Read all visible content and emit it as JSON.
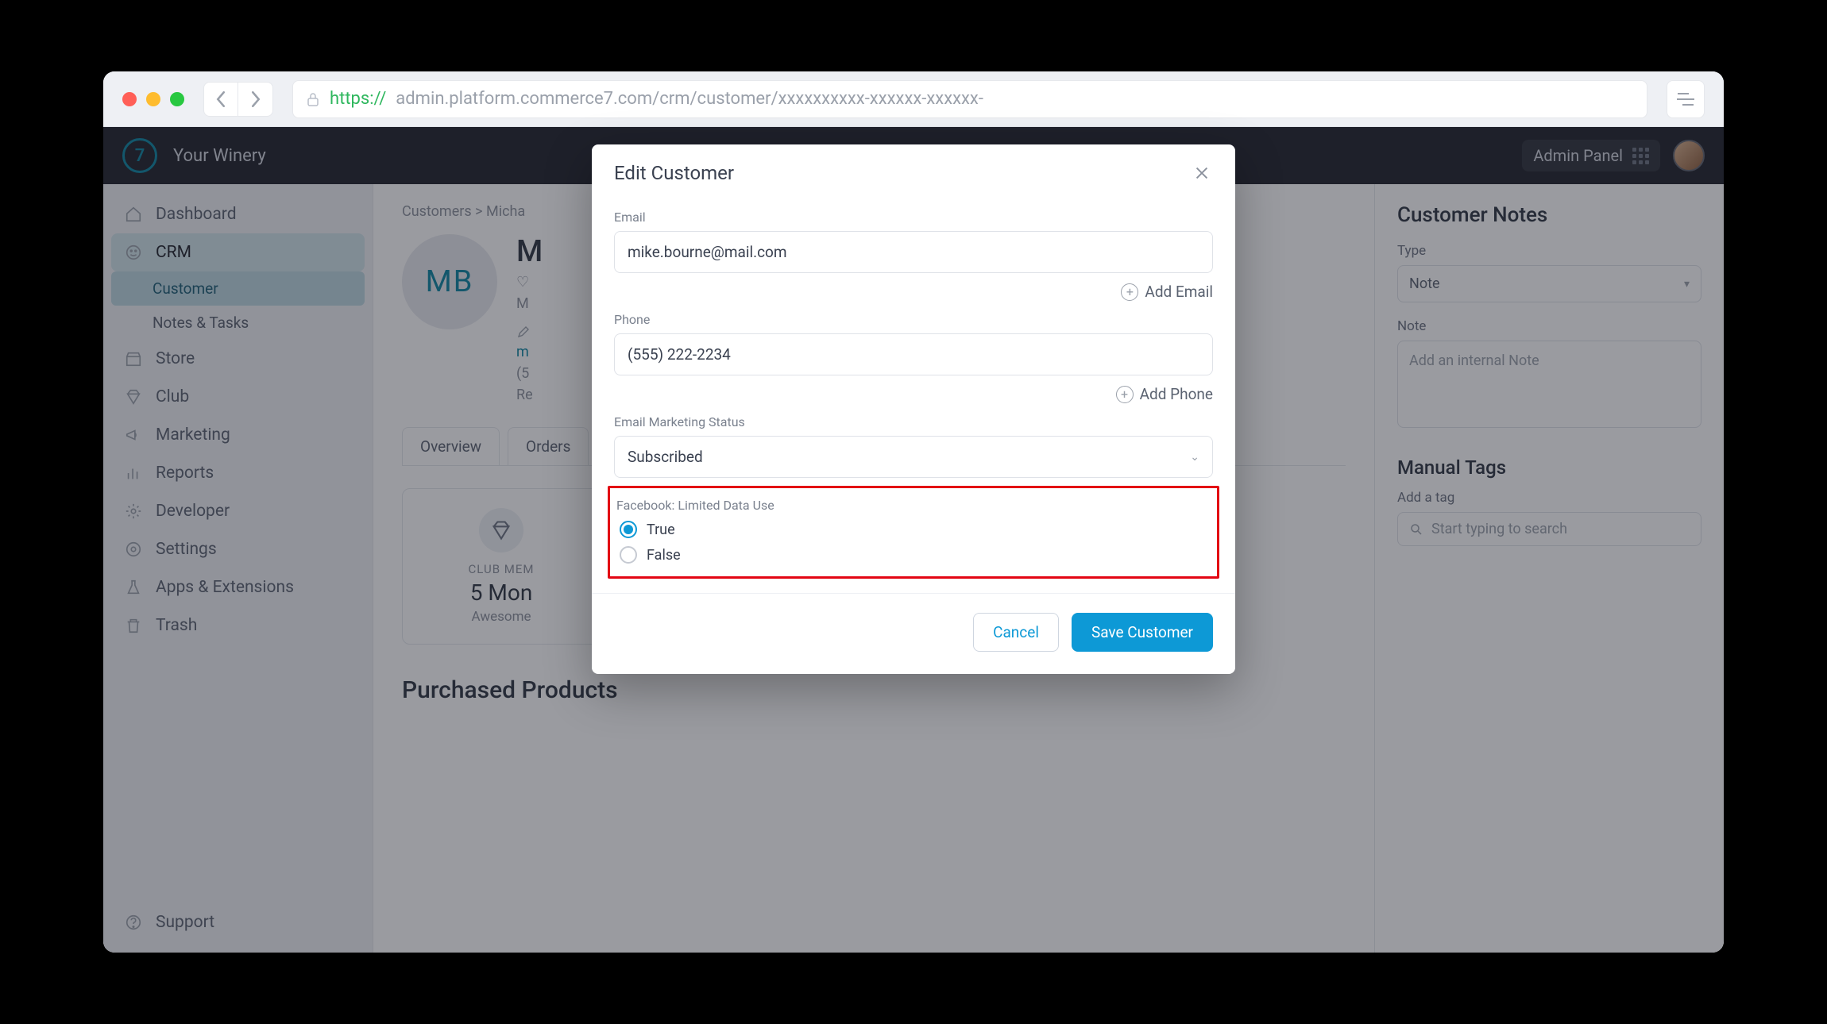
{
  "browser": {
    "url_scheme": "https://",
    "url_rest": "admin.platform.commerce7.com/crm/customer/xxxxxxxxxx-xxxxxx-xxxxxx-"
  },
  "appbar": {
    "brand": "Your Winery",
    "logo_char": "7",
    "admin_panel": "Admin Panel"
  },
  "sidebar": {
    "items": [
      {
        "label": "Dashboard"
      },
      {
        "label": "CRM"
      },
      {
        "label": "Store"
      },
      {
        "label": "Club"
      },
      {
        "label": "Marketing"
      },
      {
        "label": "Reports"
      },
      {
        "label": "Developer"
      },
      {
        "label": "Settings"
      },
      {
        "label": "Apps & Extensions"
      },
      {
        "label": "Trash"
      }
    ],
    "sub": {
      "customer": "Customer",
      "notes": "Notes & Tasks"
    },
    "support": "Support"
  },
  "breadcrumb": {
    "root": "Customers",
    "sep": ">",
    "name": "Micha"
  },
  "customer": {
    "initials": "MB",
    "name": "M",
    "line1": "M",
    "email_fragment": "m",
    "phone_fragment": "(5",
    "re_line": "Re"
  },
  "tabs": {
    "overview": "Overview",
    "orders": "Orders"
  },
  "stat": {
    "label": "CLUB MEM",
    "value": "5 Mon",
    "sub": "Awesome"
  },
  "section_purchased": "Purchased Products",
  "rightcol": {
    "notes_h": "Customer Notes",
    "type_label": "Type",
    "type_value": "Note",
    "note_label": "Note",
    "note_placeholder": "Add an internal Note",
    "manual_tags_h": "Manual Tags",
    "add_tag_label": "Add a tag",
    "search_placeholder": "Start typing to search"
  },
  "modal": {
    "title": "Edit Customer",
    "email_label": "Email",
    "email_value": "mike.bourne@mail.com",
    "add_email": "Add Email",
    "phone_label": "Phone",
    "phone_value": "(555) 222-2234",
    "add_phone": "Add Phone",
    "ems_label": "Email Marketing Status",
    "ems_value": "Subscribed",
    "ldu_label": "Facebook: Limited Data Use",
    "radio_true": "True",
    "radio_false": "False",
    "cancel": "Cancel",
    "save": "Save Customer"
  }
}
